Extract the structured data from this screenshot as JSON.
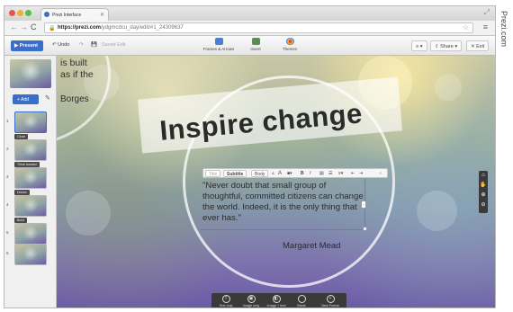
{
  "browser": {
    "tab_title": "Prezi Interface",
    "url_domain": "https://prezi.com",
    "url_path": "/ydgmcdcu_day/edit/#1_24309637"
  },
  "toolbar": {
    "present_label": "Present",
    "undo_label": "Undo",
    "save_label": "Saved Edit",
    "frames_label": "Frames & Arrows",
    "insert_label": "Insert",
    "themes_label": "Themes",
    "share_label": "Share",
    "exit_label": "Exit"
  },
  "canvas": {
    "ghost_quote": [
      "is built",
      "as if the"
    ],
    "ghost_author": "Borges",
    "headline": "Inspire change",
    "quote": "\"Never doubt that small group of thoughtful, committed citizens can change the world. Indeed, it is the only thing that ever has.\"",
    "author": "Margaret Mead"
  },
  "format_bar": {
    "title": "Title",
    "subtitle": "Subtitle",
    "body": "Body",
    "font_small": "A",
    "font_large": "A",
    "bold": "B",
    "italic": "I"
  },
  "bottom_bar": [
    {
      "icon": "T",
      "label": "Text only"
    },
    {
      "icon": "▣",
      "label": "Image only"
    },
    {
      "icon": "◧",
      "label": "Image + text"
    },
    {
      "icon": "",
      "label": "Blank"
    },
    {
      "icon": "+",
      "label": "New Frame"
    }
  ],
  "sidebar": {
    "add_label": "+ Add",
    "thumbnails": [
      {
        "num": "1",
        "label": ""
      },
      {
        "num": "2",
        "label": "Circle"
      },
      {
        "num": "3",
        "label": "Think forward"
      },
      {
        "num": "4",
        "label": "Dream"
      },
      {
        "num": "5",
        "label": "Build"
      },
      {
        "num": "6",
        "label": ""
      }
    ]
  },
  "watermark": "Prezi.com"
}
